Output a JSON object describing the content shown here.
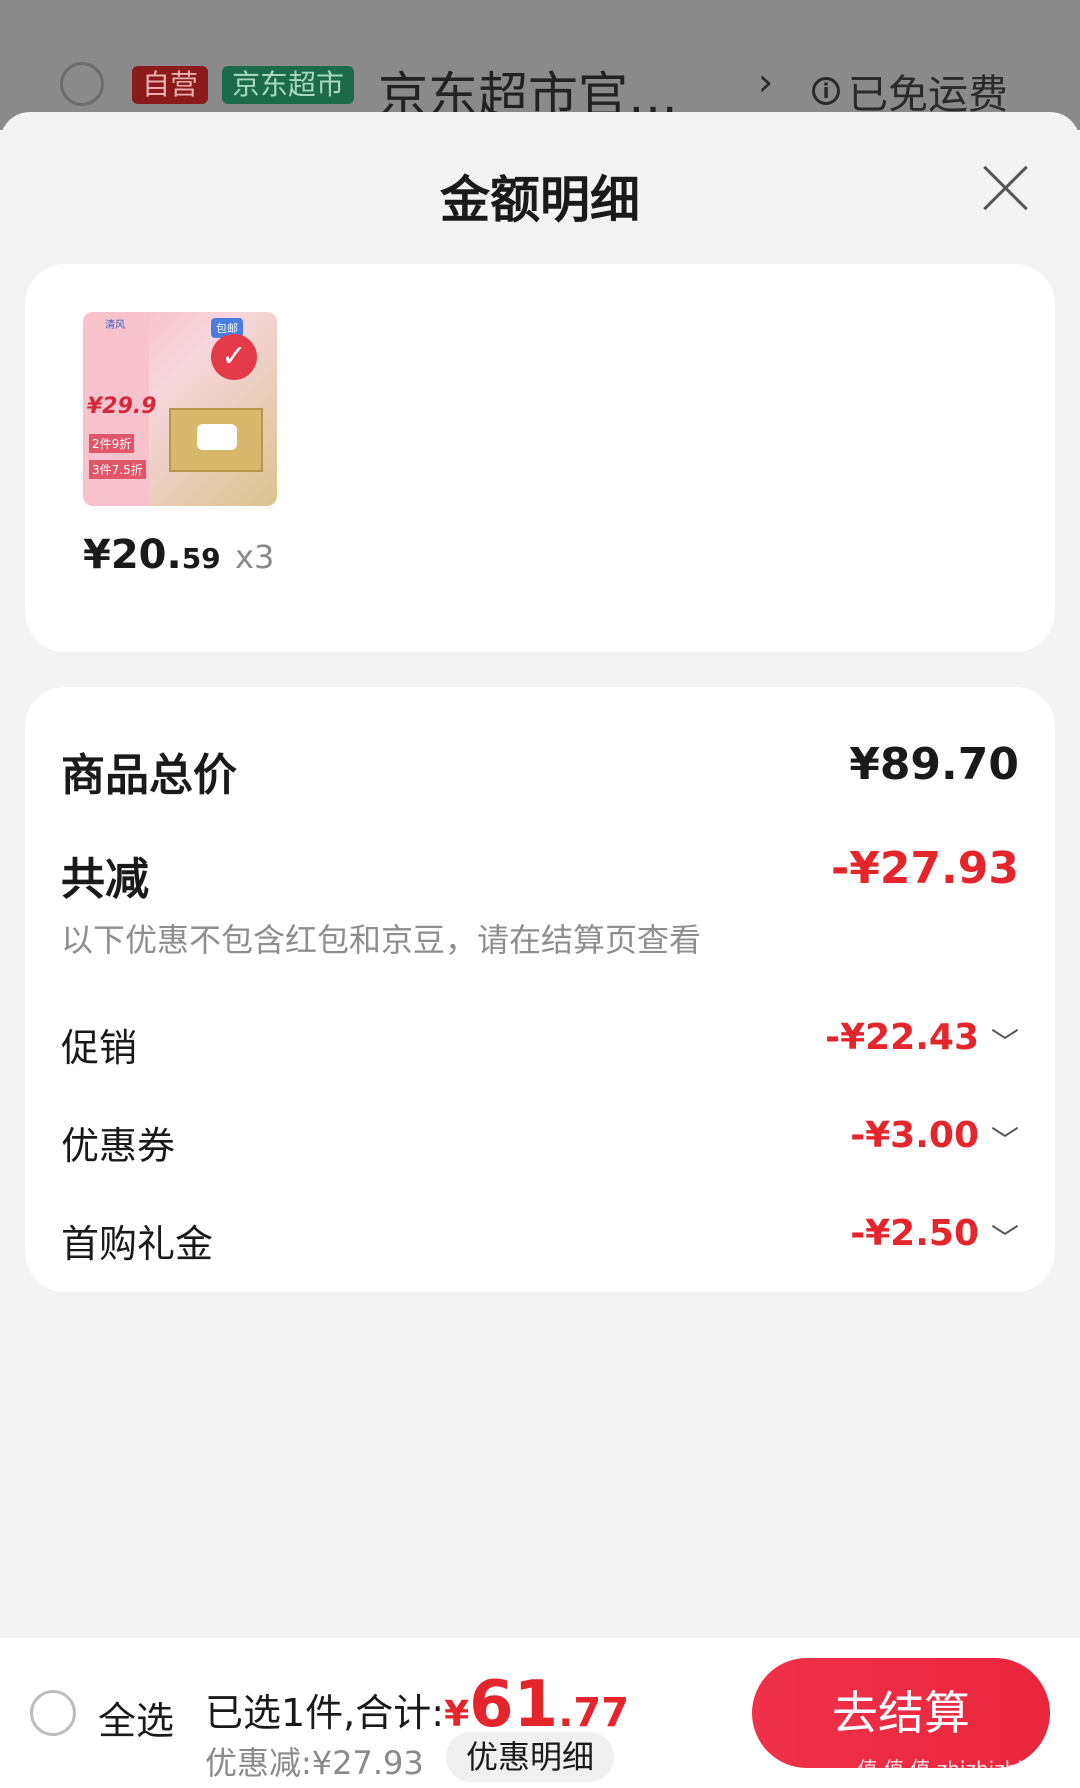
{
  "background_store": {
    "tag_self": "自营",
    "tag_jd": "京东超市",
    "store_name": "京东超市官…",
    "arrow": "›",
    "shipping": "已免运费"
  },
  "sheet": {
    "title": "金额明细"
  },
  "product": {
    "unit_price_int": "¥20.",
    "unit_price_dec": "59",
    "quantity": "x3",
    "thumb": {
      "brand": "清风",
      "price": "¥29.9",
      "promo1": "2件9折",
      "promo2": "3件7.5折",
      "badge": "包邮"
    }
  },
  "summary": {
    "total_label": "商品总价",
    "total_value": "¥89.70",
    "reduce_label": "共减",
    "reduce_value": "-¥27.93",
    "note": "以下优惠不包含红包和京豆，请在结算页查看",
    "items": [
      {
        "label": "促销",
        "value": "-¥22.43"
      },
      {
        "label": "优惠券",
        "value": "-¥3.00"
      },
      {
        "label": "首购礼金",
        "value": "-¥2.50"
      }
    ]
  },
  "bottom_bar": {
    "select_all": "全选",
    "selected_text": "已选1件,合计:",
    "total_currency": "¥",
    "total_int": "61",
    "total_dec": ".77",
    "discount_text": "优惠减:¥27.93",
    "detail_button": "优惠明细",
    "checkout_button": "去结算"
  },
  "watermark": "值 值 值 zhizhizhi.com",
  "colors": {
    "accent_red": "#e4262c",
    "checkout_red": "#f0314a"
  }
}
